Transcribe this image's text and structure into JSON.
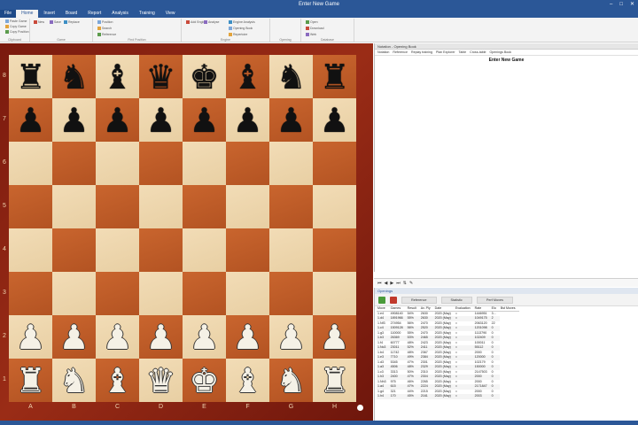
{
  "window": {
    "title": "Enter New Game"
  },
  "ribbon_tabs": [
    {
      "label": "File"
    },
    {
      "label": "Home"
    },
    {
      "label": "Insert"
    },
    {
      "label": "Board"
    },
    {
      "label": "Report"
    },
    {
      "label": "Analysis"
    },
    {
      "label": "Training"
    },
    {
      "label": "View"
    }
  ],
  "active_tab_index": 1,
  "ribbon": {
    "groups": [
      "Clipboard",
      "Game",
      "Find Position",
      "Engine",
      "Opening",
      "Database"
    ],
    "buttons": [
      "Paste Game",
      "Copy Game",
      "Copy Position",
      "New",
      "Save",
      "Replace",
      "Position",
      "Search",
      "Reference",
      "Add Engine",
      "Analyse",
      "Engine Analysis",
      "Opening Book",
      "Repertoire",
      "Open",
      "Download",
      "Web"
    ]
  },
  "colors": {
    "accent": "#2b5797",
    "board_frame": "#8b2412",
    "light_square": "#efd7ae",
    "dark_square": "#c05d28"
  },
  "board": {
    "ranks": [
      "8",
      "7",
      "6",
      "5",
      "4",
      "3",
      "2",
      "1"
    ],
    "files": [
      "A",
      "B",
      "C",
      "D",
      "E",
      "F",
      "G",
      "H"
    ],
    "position": [
      [
        "r",
        "n",
        "b",
        "q",
        "k",
        "b",
        "n",
        "r"
      ],
      [
        "p",
        "p",
        "p",
        "p",
        "p",
        "p",
        "p",
        "p"
      ],
      [
        "",
        "",
        "",
        "",
        "",
        "",
        "",
        ""
      ],
      [
        "",
        "",
        "",
        "",
        "",
        "",
        "",
        ""
      ],
      [
        "",
        "",
        "",
        "",
        "",
        "",
        "",
        ""
      ],
      [
        "",
        "",
        "",
        "",
        "",
        "",
        "",
        ""
      ],
      [
        "P",
        "P",
        "P",
        "P",
        "P",
        "P",
        "P",
        "P"
      ],
      [
        "R",
        "N",
        "B",
        "Q",
        "K",
        "B",
        "N",
        "R"
      ]
    ],
    "side_to_move_indicator": "white"
  },
  "notation": {
    "header": "Notation - Opening Book",
    "subtabs": [
      "Notation",
      "Reference",
      "Replay training",
      "Plan Explorer",
      "Table",
      "Cross-table",
      "Openings Book"
    ],
    "game_title": "Enter New Game"
  },
  "nav_toolbar": {
    "icons": [
      "first-icon",
      "prev-icon",
      "next-icon",
      "last-icon",
      "flip-icon",
      "comment-icon"
    ]
  },
  "book": {
    "header": "Openings",
    "bar_buttons": [
      "Reference",
      "Statistic",
      "Perf Moves"
    ],
    "columns": [
      "Move",
      "Games",
      "Result",
      "Av. Ply",
      "Date",
      "Evaluation",
      "Rate",
      "Elo",
      "Bst Moves"
    ],
    "rows": [
      [
        "1.e4",
        "4908140",
        "54%",
        "2630",
        "2020 (May)",
        "=",
        "1446951",
        "3..."
      ],
      [
        "1.d4",
        "1891966",
        "55%",
        "2630",
        "2020 (May)",
        "=",
        "1049175",
        "2"
      ],
      [
        "1.Nf3",
        "274954",
        "56%",
        "2470",
        "2020 (May)",
        "=",
        "2063120",
        "22"
      ],
      [
        "1.c4",
        "1509128",
        "56%",
        "2520",
        "2020 (May)",
        "=",
        "1201098",
        "0"
      ],
      [
        "1.g3",
        "110000",
        "55%",
        "2470",
        "2020 (May)",
        "=",
        "1113790",
        "0"
      ],
      [
        "1.b3",
        "26369",
        "53%",
        "2465",
        "2020 (May)",
        "=",
        "102409",
        "0"
      ],
      [
        "1.f4",
        "60777",
        "48%",
        "2423",
        "2020 (May)",
        "=",
        "100011",
        "0"
      ],
      [
        "1.Nc3",
        "23011",
        "52%",
        "2411",
        "2020 (May)",
        "=",
        "55112",
        "0"
      ],
      [
        "1.b4",
        "11742",
        "48%",
        "2367",
        "2020 (May)",
        "=",
        "2000",
        "0"
      ],
      [
        "1.e3",
        "7710",
        "49%",
        "2384",
        "2020 (May)",
        "=",
        "120000",
        "0"
      ],
      [
        "1.d3",
        "5345",
        "47%",
        "2301",
        "2020 (May)",
        "=",
        "102179",
        "0"
      ],
      [
        "1.a3",
        "4506",
        "48%",
        "2329",
        "2020 (May)",
        "=",
        "150000",
        "0"
      ],
      [
        "1.c3",
        "3313",
        "50%",
        "2310",
        "2020 (May)",
        "=",
        "2147503",
        "0"
      ],
      [
        "1.h3",
        "2400",
        "47%",
        "2304",
        "2020 (May)",
        "=",
        "2000",
        "0"
      ],
      [
        "1.Nh3",
        "975",
        "46%",
        "2265",
        "2020 (May)",
        "=",
        "2000",
        "0"
      ],
      [
        "1.a4",
        "615",
        "47%",
        "2224",
        "2020 (May)",
        "=",
        "2171847",
        "0"
      ],
      [
        "1.g4",
        "321",
        "44%",
        "2215",
        "2020 (May)",
        "=",
        "2000",
        "0"
      ],
      [
        "1.h4",
        "170",
        "45%",
        "2161",
        "2020 (May)",
        "=",
        "2003",
        "0"
      ]
    ]
  }
}
